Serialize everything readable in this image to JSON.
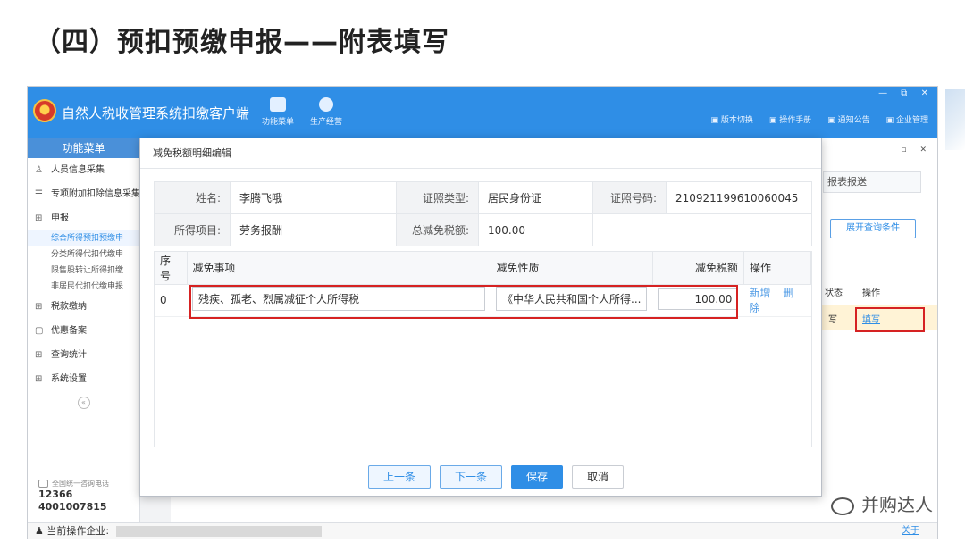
{
  "slide": {
    "title": "（四）预扣预缴申报——附表填写",
    "watermark": "并购达人"
  },
  "app": {
    "name": "自然人税收管理系统扣缴客户端",
    "tools": [
      {
        "label": "功能菜单",
        "icon": "menu-icon"
      },
      {
        "label": "生产经营",
        "icon": "coins-icon"
      }
    ],
    "right_links": [
      "版本切换",
      "操作手册",
      "通知公告",
      "企业管理"
    ],
    "window_controls": "— ⧉ ✕"
  },
  "sidebar": {
    "header": "功能菜单",
    "items": [
      {
        "label": "人员信息采集",
        "icon": "person-icon"
      },
      {
        "label": "专项附加扣除信息采集",
        "icon": "list-icon"
      },
      {
        "label": "申报",
        "icon": "grid-icon"
      }
    ],
    "sub_items": [
      {
        "label": "综合所得预扣预缴申",
        "active": true
      },
      {
        "label": "分类所得代扣代缴申",
        "active": false
      },
      {
        "label": "限售股转让所得扣缴",
        "active": false
      },
      {
        "label": "非居民代扣代缴申报",
        "active": false
      }
    ],
    "items_after": [
      {
        "label": "税款缴纳",
        "icon": "grid-icon"
      },
      {
        "label": "优惠备案",
        "icon": "doc-icon"
      },
      {
        "label": "查询统计",
        "icon": "grid-icon"
      },
      {
        "label": "系统设置",
        "icon": "grid-icon"
      }
    ],
    "hotline_label": "全国统一咨询电话",
    "hotline_numbers": [
      "12366",
      "4001007815"
    ]
  },
  "statusbar": {
    "label": "当前操作企业:",
    "about": "关于"
  },
  "background": {
    "tab_label": "报表报送",
    "expand_button": "展开查询条件",
    "col_status": "状态",
    "col_action": "操作",
    "row_status": "写",
    "row_action": "填写"
  },
  "modal": {
    "title": "减免税额明细编辑",
    "info": {
      "name_label": "姓名:",
      "name_value": "李腾飞哦",
      "id_type_label": "证照类型:",
      "id_type_value": "居民身份证",
      "id_no_label": "证照号码:",
      "id_no_value": "210921199610060045",
      "income_label": "所得项目:",
      "income_value": "劳务报酬",
      "total_label": "总减免税额:",
      "total_value": "100.00"
    },
    "columns": [
      "序号",
      "减免事项",
      "减免性质",
      "减免税额",
      "操作"
    ],
    "rows": [
      {
        "index": "0",
        "item": "残疾、孤老、烈属减征个人所得税",
        "nature": "《中华人民共和国个人所得...",
        "amount": "100.00",
        "add": "新增",
        "delete": "删除"
      }
    ],
    "buttons": {
      "prev": "上一条",
      "next": "下一条",
      "save": "保存",
      "cancel": "取消"
    }
  }
}
